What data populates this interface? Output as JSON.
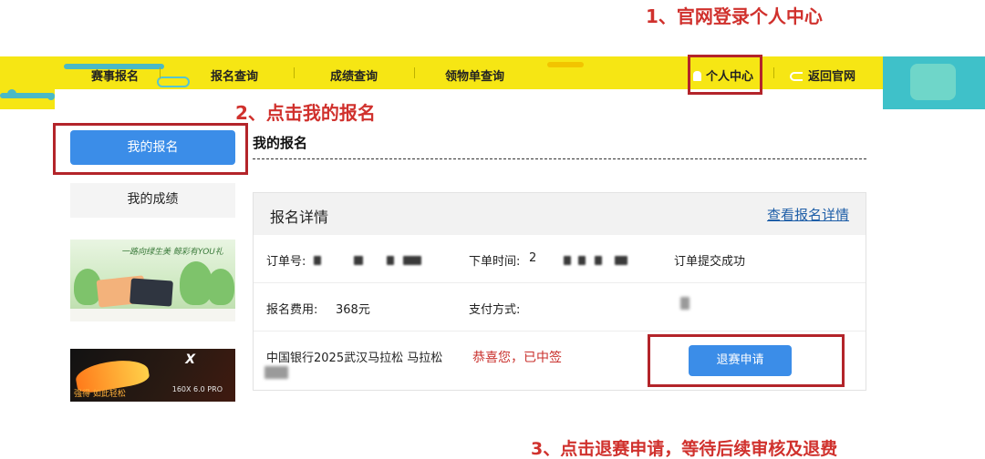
{
  "annotations": {
    "step1": "1、官网登录个人中心",
    "step2": "2、点击我的报名",
    "step3": "3、点击退赛申请，等待后续审核及退费"
  },
  "topnav": {
    "items": [
      "赛事报名",
      "报名查询",
      "成绩查询",
      "领物单查询"
    ],
    "personal_center": "个人中心",
    "return_site": "返回官网"
  },
  "sidebar": {
    "my_registration": "我的报名",
    "my_scores": "我的成绩",
    "ad1_slogan": "一路向绿生美 鲸彩有YOU礼",
    "ad2_brand": "X",
    "ad2_model": "160X 6.0 PRO",
    "ad2_tagline": "强得 如此轻松"
  },
  "content": {
    "title": "我的报名",
    "card_title": "报名详情",
    "view_details": "查看报名详情",
    "order_no_label": "订单号:",
    "order_time_label": "下单时间:",
    "order_time_prefix": "2",
    "order_status": "订单提交成功",
    "fee_label": "报名费用:",
    "fee_value": "368元",
    "payment_label": "支付方式:",
    "race_name": "中国银行2025武汉马拉松   马拉松",
    "race_status": "恭喜您，已中签",
    "withdraw_button": "退赛申请"
  },
  "colors": {
    "banner_yellow": "#f6e614",
    "primary_blue": "#3b8de8",
    "annotation_red": "#d0312d",
    "status_red": "#c9302c",
    "link_blue": "#1f5fa8"
  }
}
